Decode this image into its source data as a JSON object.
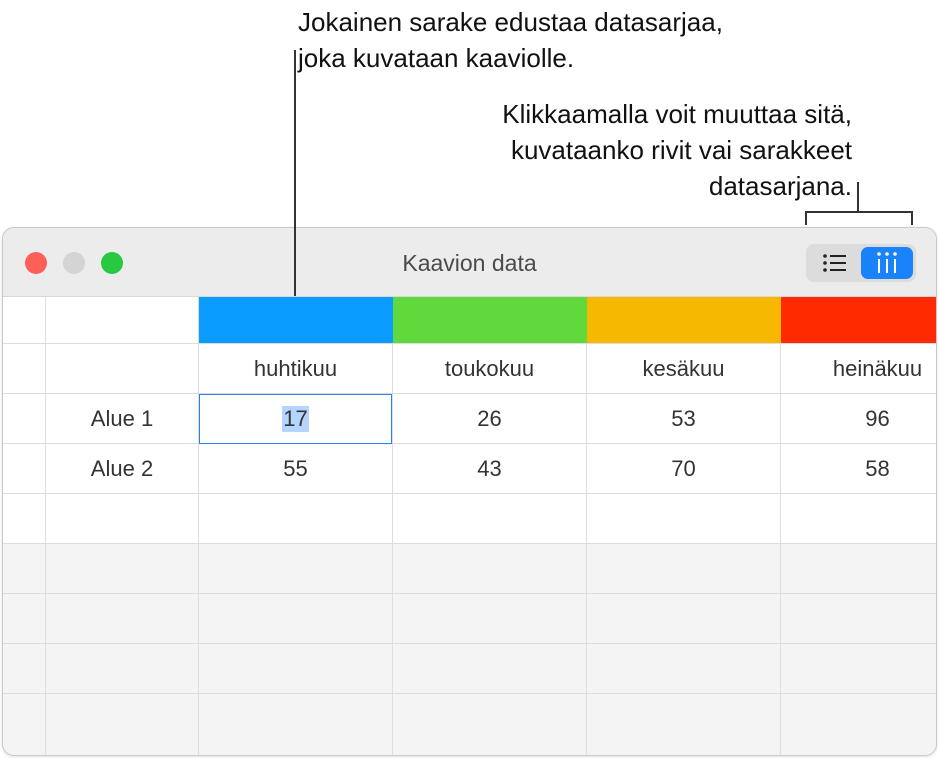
{
  "callouts": {
    "series_line1": "Jokainen sarake edustaa datasarjaa,",
    "series_line2": "joka kuvataan kaaviolle.",
    "toggle_line1": "Klikkaamalla voit muuttaa sitä,",
    "toggle_line2": "kuvataanko rivit vai sarakkeet",
    "toggle_line3": "datasarjana."
  },
  "window": {
    "title": "Kaavion data",
    "traffic_colors": {
      "close": "#fe5f57",
      "minimize": "#d4d4d4",
      "zoom": "#28c840"
    },
    "plot_toggle": {
      "rows_icon": "list-icon",
      "columns_icon": "columns-icon",
      "active": "columns"
    }
  },
  "table": {
    "series_colors": [
      "#0a9bff",
      "#5fd93c",
      "#f6b800",
      "#ff2a00"
    ],
    "columns": [
      "huhtikuu",
      "toukokuu",
      "kesäkuu",
      "heinäkuu"
    ],
    "rows": [
      {
        "label": "Alue 1",
        "values": [
          "17",
          "26",
          "53",
          "96"
        ]
      },
      {
        "label": "Alue 2",
        "values": [
          "55",
          "43",
          "70",
          "58"
        ]
      }
    ]
  }
}
